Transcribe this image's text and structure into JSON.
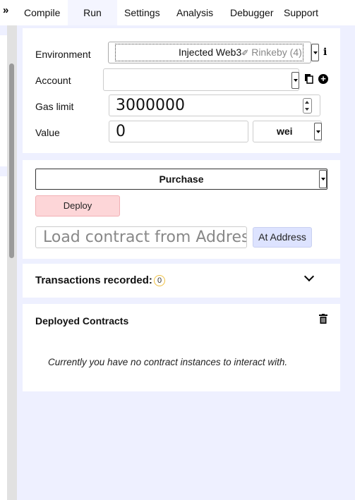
{
  "nav": {
    "expand_icon": "double-chevron-right-icon",
    "tabs": [
      {
        "label": "Compile",
        "active": false
      },
      {
        "label": "Run",
        "active": true
      },
      {
        "label": "Settings",
        "active": false
      },
      {
        "label": "Analysis",
        "active": false
      },
      {
        "label": "Debugger",
        "active": false
      },
      {
        "label": "Support",
        "active": false
      }
    ]
  },
  "settings": {
    "environment_label": "Environment",
    "environment_value": "Injected Web3",
    "environment_network": "Rinkeby (4)",
    "account_label": "Account",
    "account_value": "",
    "gas_limit_label": "Gas limit",
    "gas_limit_value": "3000000",
    "value_label": "Value",
    "value_value": "0",
    "value_unit": "wei",
    "info_icon": "info-icon"
  },
  "contract": {
    "selected": "Purchase",
    "deploy_label": "Deploy",
    "address_placeholder": "Load contract from Address",
    "at_address_label": "At Address"
  },
  "transactions": {
    "label": "Transactions recorded:",
    "count": "0"
  },
  "deployed": {
    "title": "Deployed Contracts",
    "empty_message": "Currently you have no contract instances to interact with."
  },
  "colors": {
    "main_background": "#eef0ff",
    "deploy_button": "#fdd6d8",
    "at_address_button": "#dde3ff",
    "active_tab": "#f4f5ff"
  }
}
